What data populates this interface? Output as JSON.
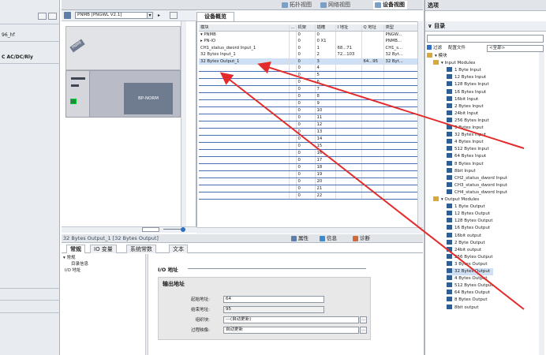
{
  "left_panel": {
    "rows": [
      "96_hf",
      "C AC/DC/Rly"
    ]
  },
  "view_tabs": {
    "topology": "拓扑视图",
    "network": "网络视图",
    "device": "设备视图"
  },
  "device_view": {
    "device_select": "PNMB [PNGWL V2.1]",
    "device_label": "PNMB",
    "module_label": "BP-NORM"
  },
  "overview": {
    "tab_label": "设备概览",
    "columns": [
      "模块",
      "...",
      "机架",
      "插槽",
      "I 地址",
      "Q 地址",
      "类型"
    ],
    "rows": [
      {
        "module": "PNMB",
        "rack": "0",
        "slot": "0",
        "i_addr": "",
        "q_addr": "",
        "type": "PNGW..."
      },
      {
        "module": "PN-IO",
        "rack": "0",
        "slot": "0 X1",
        "i_addr": "",
        "q_addr": "",
        "type": "PNMB..."
      },
      {
        "module": "CH1_status_dword Input_1",
        "rack": "0",
        "slot": "1",
        "i_addr": "68...71",
        "q_addr": "",
        "type": "CH1_s..."
      },
      {
        "module": "32 Bytes Input_1",
        "rack": "0",
        "slot": "2",
        "i_addr": "72...103",
        "q_addr": "",
        "type": "32 Byt..."
      },
      {
        "module": "32 Bytes Output_1",
        "rack": "0",
        "slot": "3",
        "i_addr": "",
        "q_addr": "64...95",
        "type": "32 Byt..."
      }
    ],
    "empty_slots": [
      "4",
      "5",
      "6",
      "7",
      "8",
      "9",
      "10",
      "11",
      "12",
      "13",
      "14",
      "15",
      "16",
      "17",
      "18",
      "19",
      "20",
      "21",
      "22"
    ],
    "empty_rack": "0"
  },
  "properties": {
    "title": "32 Bytes Output_1 [32 Bytes Output]",
    "top_tabs": {
      "props": "属性",
      "info": "信息",
      "diag": "诊断"
    },
    "tabs": [
      "常规",
      "IO 变量",
      "系统常数",
      "文本"
    ],
    "tree": {
      "general": "常规",
      "catalog_info": "目录信息",
      "io_address": "I/O 地址"
    },
    "io_section": "I/O 地址",
    "output_section": "输出地址",
    "fields": {
      "start_label": "起始地址:",
      "start_value": "64",
      "end_label": "结束地址:",
      "end_value": "95",
      "org_label": "组织块:",
      "org_value": "---(自动更新)",
      "proc_label": "过程映像:",
      "proc_value": "自动更新"
    }
  },
  "options_panel": {
    "title": "选项",
    "catalog_header": "目录",
    "filter_label": "过滤",
    "profile_label": "配置文件",
    "profile_value": "<全部>",
    "tree": {
      "modules": "模块",
      "input_modules": "Input Modules",
      "inputs": [
        "1 Byte Input",
        "12 Bytes Input",
        "128 Bytes Input",
        "16 Bytes Input",
        "16bit Input",
        "2 Bytes Input",
        "24bit Input",
        "256 Bytes Input",
        "3 Bytes Input",
        "32 Bytes Input",
        "4 Bytes Input",
        "512 Bytes Input",
        "64 Bytes Input",
        "8 Bytes Input",
        "8bit Input",
        "CH2_status_dword Input",
        "CH3_status_dword Input",
        "CH4_status_dword Input"
      ],
      "output_modules": "Output Modules",
      "outputs": [
        "1 Byte Output",
        "12 Bytes Output",
        "128 Bytes Output",
        "16 Bytes Output",
        "16bit output",
        "2 Byte Output",
        "24bit output",
        "256 Bytes Output",
        "3 Bytes Output",
        "32 Bytes Output",
        "4 Bytes Output",
        "512 Bytes Output",
        "64 Bytes Output",
        "8 Bytes Output",
        "8bit output"
      ],
      "selected": "32 Bytes Output"
    }
  },
  "colors": {
    "accent": "#2f5f92",
    "selection": "#cfe0f4",
    "arrow": "#e32b2b"
  }
}
